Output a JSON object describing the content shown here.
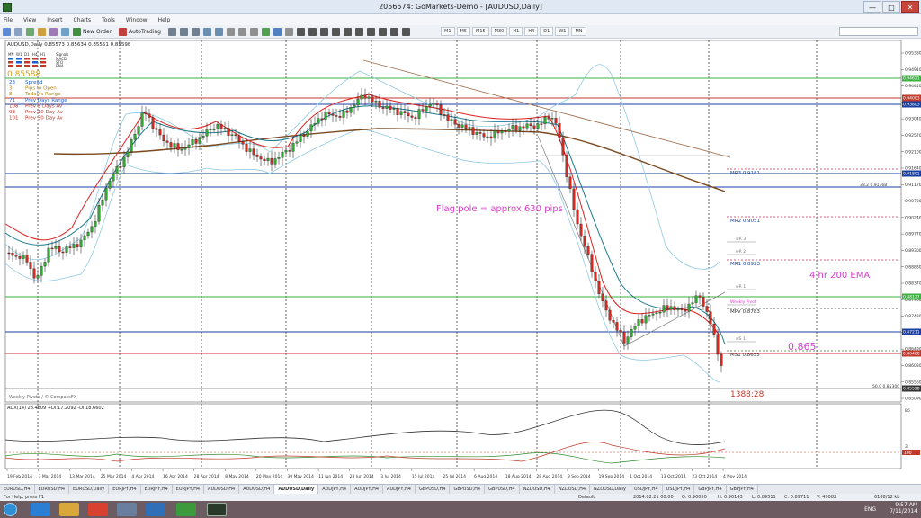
{
  "window": {
    "title": "2056574: GoMarkets-Demo - [AUDUSD,Daily]",
    "minimize": "—",
    "maximize": "□",
    "close": "✕"
  },
  "menu": [
    "File",
    "View",
    "Insert",
    "Charts",
    "Tools",
    "Window",
    "Help"
  ],
  "toolbar": {
    "new_order": "New Order",
    "autotrading": "AutoTrading",
    "timeframes": [
      "M1",
      "M5",
      "M15",
      "M30",
      "H1",
      "H4",
      "D1",
      "W1",
      "MN"
    ]
  },
  "chart": {
    "header": "AUDUSD,Daily  0.85573 0.85634 0.85551 0.85598",
    "price_big": "0.85588",
    "info_panel": {
      "tf": [
        "MN",
        "W1",
        "D1",
        "H4",
        "H1",
        "Signals"
      ],
      "rows": [
        {
          "n": "23",
          "label": "Spread",
          "color": "#1a5fd0"
        },
        {
          "n": "3",
          "label": "Pips to Open",
          "color": "#b8860b"
        },
        {
          "n": "8",
          "label": "Today's Range",
          "color": "#b8860b"
        },
        {
          "n": "71",
          "label": "Prev Days Range",
          "color": "#1a5fd0"
        },
        {
          "n": "108",
          "label": "Prev 5 Days Av",
          "color": "#c0392b"
        },
        {
          "n": "98",
          "label": "Prev 10 Day Av",
          "color": "#c0392b"
        },
        {
          "n": "101",
          "label": "Prev 30 Day Av",
          "color": "#c0392b"
        }
      ],
      "side": [
        "MACD",
        "STO",
        "EMA"
      ]
    },
    "annotations": {
      "flagpole": "Flag pole = approx 630 pips",
      "ema200": "4 hr 200 EMA",
      "level_865": "0.865",
      "countdown": "1388:28",
      "credit": "Weekly Pivots / © CompassFX"
    },
    "pivot_labels": [
      {
        "text": "MR3  0.9181"
      },
      {
        "text": "38.2  0.91368"
      },
      {
        "text": "MR2  0.9051"
      },
      {
        "text": "wR 3"
      },
      {
        "text": "wR 2"
      },
      {
        "text": "MR1  0.8923"
      },
      {
        "text": "wR 1"
      },
      {
        "text": "Weekly Pivot"
      },
      {
        "text": "MPV  0.8783"
      },
      {
        "text": "wS 1"
      },
      {
        "text": "MS1  0.8655"
      },
      {
        "text": "50.0  0.85300"
      }
    ],
    "price_axis": [
      "0.95380",
      "0.94910",
      "0.94440",
      "0.93510",
      "0.93040",
      "0.92570",
      "0.92100",
      "0.91640",
      "0.91170",
      "0.90700",
      "0.90240",
      "0.89770",
      "0.89300",
      "0.88830",
      "0.88370",
      "0.87900",
      "0.87430",
      "0.86960",
      "0.86490",
      "0.86030",
      "0.85560",
      "0.85090"
    ],
    "price_tags": [
      {
        "text": "0.94621",
        "color": "#3cb043"
      },
      {
        "text": "0.94003",
        "color": "#c0392b"
      },
      {
        "text": "0.93803",
        "color": "#1a3fa0"
      },
      {
        "text": "0.91801",
        "color": "#1a3fa0"
      },
      {
        "text": "0.88127",
        "color": "#3cb043"
      },
      {
        "text": "0.87211",
        "color": "#1a3fa0"
      },
      {
        "text": "0.86488",
        "color": "#c0392b"
      },
      {
        "text": "0.85598",
        "color": "#333333"
      }
    ],
    "date_axis": [
      "19 Feb 2014",
      "3 Mar 2014",
      "13 Mar 2014",
      "25 Mar 2014",
      "4 Apr 2014",
      "16 Apr 2014",
      "28 Apr 2014",
      "8 May 2014",
      "20 May 2014",
      "30 May 2014",
      "11 Jun 2014",
      "23 Jun 2014",
      "3 Jul 2014",
      "15 Jul 2014",
      "25 Jul 2014",
      "6 Aug 2014",
      "18 Aug 2014",
      "28 Aug 2014",
      "9 Sep 2014",
      "19 Sep 2014",
      "1 Oct 2014",
      "13 Oct 2014",
      "23 Oct 2014",
      "4 Nov 2014"
    ],
    "adx": {
      "header": "ADX(14) 28.4609 +DI:17.2092 -DI:18.6602",
      "axis": [
        "86",
        "3",
        "100"
      ]
    }
  },
  "tabs": [
    "EURUSD,H4",
    "EURUSD,H4",
    "EURUSD,Daily",
    "EURJPY,H4",
    "EURJPY,H4",
    "EURJPY,H4",
    "AUDUSD,H4",
    "AUDUSD,H4",
    "AUDUSD,Daily",
    "AUDJPY,H4",
    "AUDJPY,H4",
    "AUDJPY,H4",
    "GBPUSD,H4",
    "GBPUSD,H4",
    "GBPUSD,H4",
    "NZDUSD,H4",
    "NZDUSD,H4",
    "NZDUSD,Daily",
    "USDJPY,H4",
    "USDJPY,H4",
    "GBPJPY,H4",
    "GBPJPY,H4"
  ],
  "active_tab_index": 8,
  "status": {
    "help": "For Help, press F1",
    "profile": "Default",
    "datetime": "2014.02.21 00:00",
    "o": "O: 0.90050",
    "h": "H: 0.90143",
    "l": "L: 0.89511",
    "c": "C: 0.89711",
    "v": "V: 49082",
    "traffic": "6188/12 kb"
  },
  "taskbar": {
    "time": "9:57 AM",
    "date": "7/11/2014",
    "lang": "ENG"
  }
}
